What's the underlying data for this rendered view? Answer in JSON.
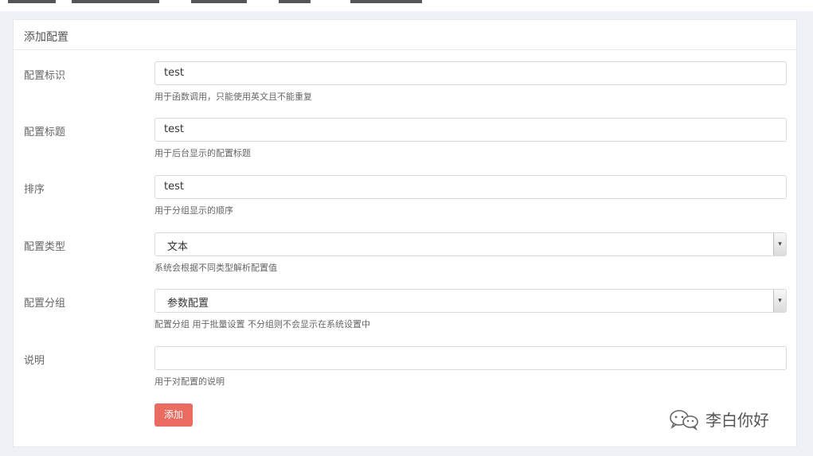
{
  "panel": {
    "title": "添加配置"
  },
  "fields": [
    {
      "label": "配置标识",
      "value": "test",
      "hint": "用于函数调用，只能使用英文且不能重复"
    },
    {
      "label": "配置标题",
      "value": "test",
      "hint": "用于后台显示的配置标题"
    },
    {
      "label": "排序",
      "value": "test",
      "hint": "用于分组显示的顺序"
    },
    {
      "label": "配置类型",
      "value": "文本",
      "hint": "系统会根据不同类型解析配置值"
    },
    {
      "label": "配置分组",
      "value": "参数配置",
      "hint": "配置分组 用于批量设置 不分组则不会显示在系统设置中"
    },
    {
      "label": "说明",
      "value": "",
      "hint": "用于对配置的说明"
    }
  ],
  "submit": {
    "label": "添加"
  },
  "watermark": {
    "text": "李白你好",
    "icon": "wechat-icon"
  },
  "colors": {
    "accent": "#ea6b5f",
    "background": "#eef1f5"
  }
}
